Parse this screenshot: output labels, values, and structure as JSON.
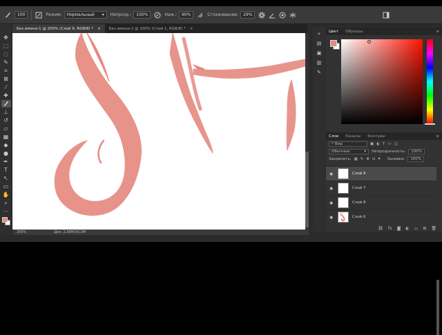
{
  "options_bar": {
    "mode_label": "Режим:",
    "mode_value": "Нормальный",
    "opacity_label": "Непрозр.:",
    "opacity_value": "100%",
    "flow_label": "Наж.:",
    "flow_value": "90%",
    "smoothing_label": "Сглаживание:",
    "smoothing_value": "29%",
    "brush_size": "100"
  },
  "tabs": [
    {
      "label": "Без имени-1 @ 200% (Слой 9, RGB/8) *",
      "close": "×"
    },
    {
      "label": "Без имени-2 @ 200% (Слой 1, RGB/8) *",
      "close": "×"
    }
  ],
  "status": {
    "zoom": "200%",
    "doc": "Док: 2,58M/30,3M"
  },
  "color_panel": {
    "tab_color": "Цвет",
    "tab_swatches": "Образцы",
    "foreground": "#e58a80",
    "background": "#ffffff"
  },
  "layers_panel": {
    "tab_layers": "Слои",
    "tab_channels": "Каналы",
    "tab_paths": "Контуры",
    "kind": "Вид",
    "blend": "Обычные",
    "opacity_label": "Непрозрачность:",
    "opacity_value": "100%",
    "lock_label": "Закрепить:",
    "fill_label": "Заливка:",
    "fill_value": "100%",
    "layers": [
      {
        "name": "Слой 9",
        "selected": true
      },
      {
        "name": "Слой 7",
        "selected": false
      },
      {
        "name": "Слой 8",
        "selected": false
      },
      {
        "name": "Слой 6",
        "selected": false
      }
    ]
  },
  "icons": {
    "brush": "brush-icon",
    "settings": "gear-icon",
    "eye": "eye-icon"
  },
  "stroke_color": "#e58a80"
}
